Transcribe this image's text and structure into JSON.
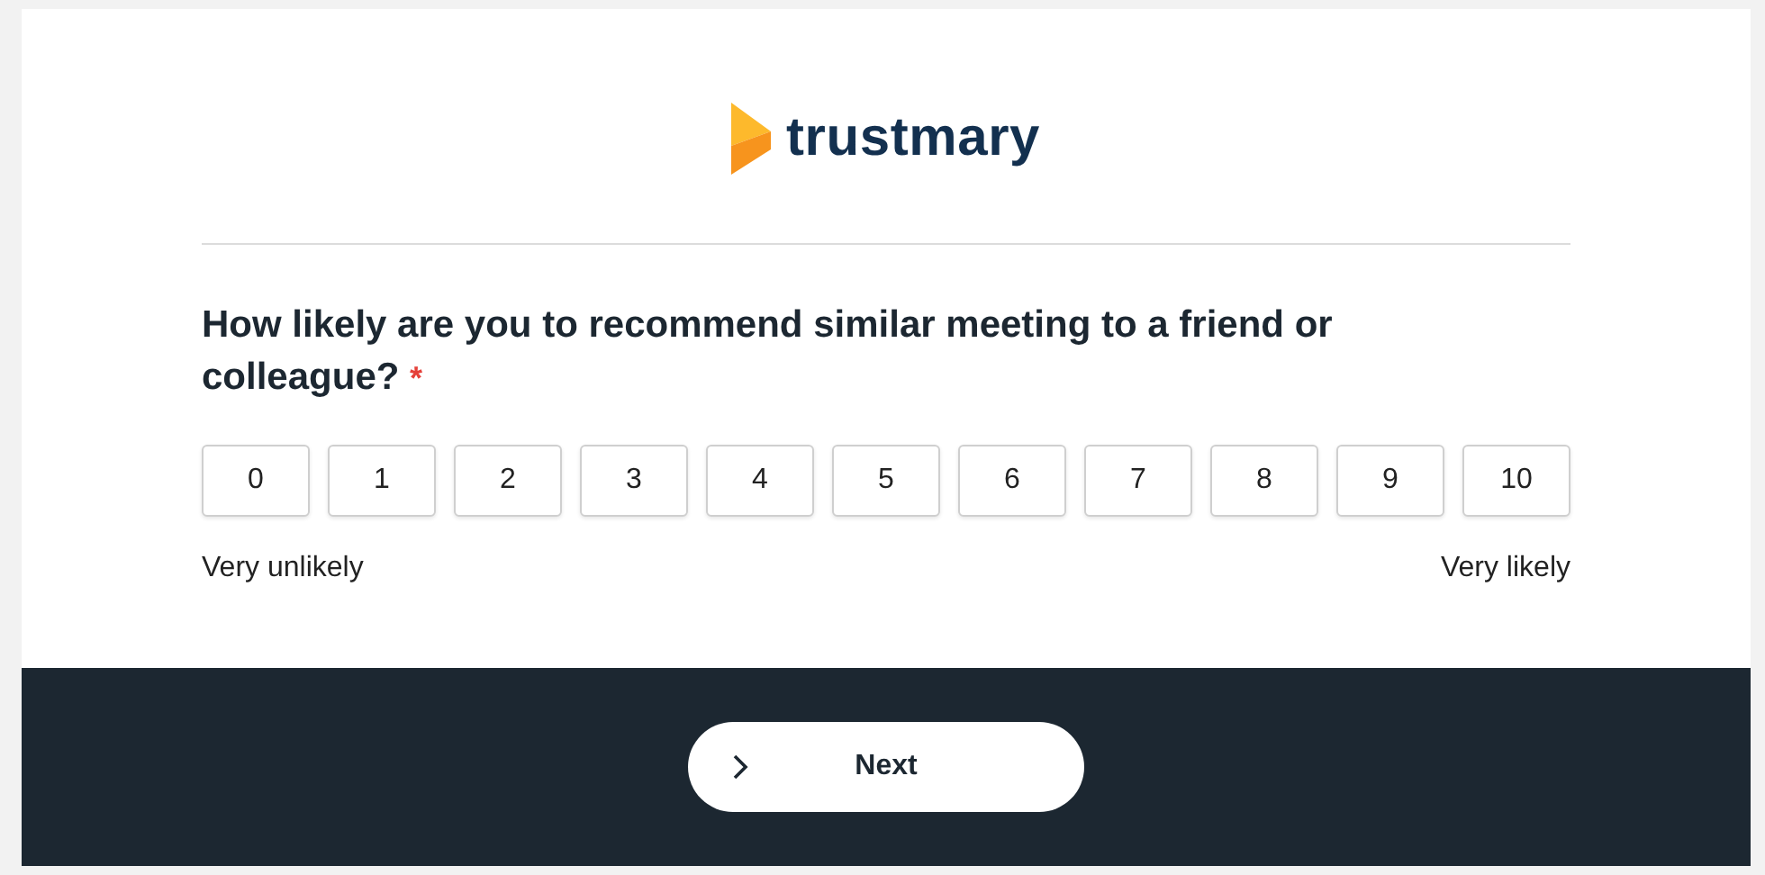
{
  "logo": {
    "text": "trustmary"
  },
  "question": {
    "text": "How likely are you to recommend similar meeting to a friend or colleague?",
    "required_mark": "*"
  },
  "scale": [
    {
      "label": "0",
      "selected": false
    },
    {
      "label": "1",
      "selected": false
    },
    {
      "label": "2",
      "selected": false
    },
    {
      "label": "3",
      "selected": false
    },
    {
      "label": "4",
      "selected": false
    },
    {
      "label": "5",
      "selected": false
    },
    {
      "label": "6",
      "selected": false
    },
    {
      "label": "7",
      "selected": false
    },
    {
      "label": "8",
      "selected": false
    },
    {
      "label": "9",
      "selected": false
    },
    {
      "label": "10",
      "selected": false
    }
  ],
  "scale_labels": {
    "low": "Very unlikely",
    "high": "Very likely"
  },
  "next_button": {
    "label": "Next"
  }
}
